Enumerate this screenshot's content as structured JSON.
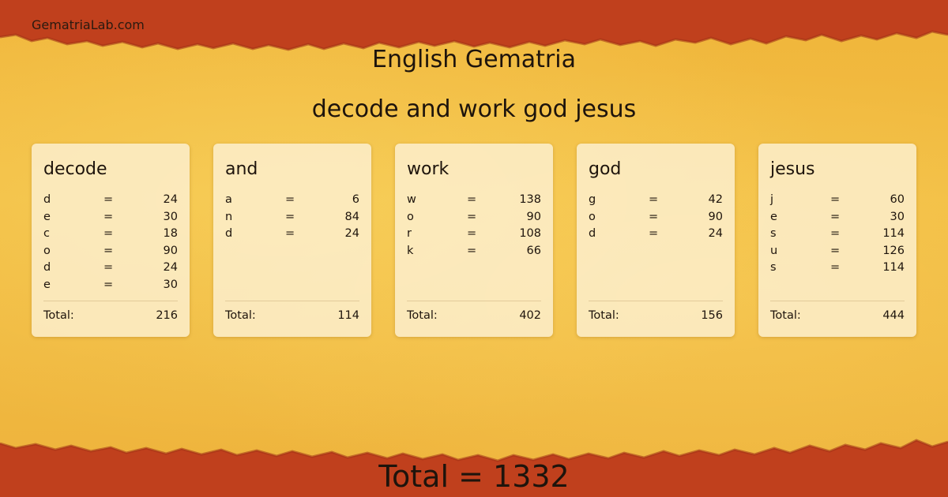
{
  "site_name": "GematriaLab.com",
  "page_title": "English Gematria",
  "phrase": "decode and work god jesus",
  "equals_sign": "=",
  "total_label": "Total:",
  "grand_total": "Total = 1332",
  "colors": {
    "torn_border": "#c0401d",
    "parchment": "#f0b53a",
    "card_background": "#fdf0d2",
    "text": "#1e140c"
  },
  "cards": [
    {
      "word": "decode",
      "letters": [
        {
          "letter": "d",
          "value": "24"
        },
        {
          "letter": "e",
          "value": "30"
        },
        {
          "letter": "c",
          "value": "18"
        },
        {
          "letter": "o",
          "value": "90"
        },
        {
          "letter": "d",
          "value": "24"
        },
        {
          "letter": "e",
          "value": "30"
        }
      ],
      "total": "216"
    },
    {
      "word": "and",
      "letters": [
        {
          "letter": "a",
          "value": "6"
        },
        {
          "letter": "n",
          "value": "84"
        },
        {
          "letter": "d",
          "value": "24"
        }
      ],
      "total": "114"
    },
    {
      "word": "work",
      "letters": [
        {
          "letter": "w",
          "value": "138"
        },
        {
          "letter": "o",
          "value": "90"
        },
        {
          "letter": "r",
          "value": "108"
        },
        {
          "letter": "k",
          "value": "66"
        }
      ],
      "total": "402"
    },
    {
      "word": "god",
      "letters": [
        {
          "letter": "g",
          "value": "42"
        },
        {
          "letter": "o",
          "value": "90"
        },
        {
          "letter": "d",
          "value": "24"
        }
      ],
      "total": "156"
    },
    {
      "word": "jesus",
      "letters": [
        {
          "letter": "j",
          "value": "60"
        },
        {
          "letter": "e",
          "value": "30"
        },
        {
          "letter": "s",
          "value": "114"
        },
        {
          "letter": "u",
          "value": "126"
        },
        {
          "letter": "s",
          "value": "114"
        }
      ],
      "total": "444"
    }
  ]
}
